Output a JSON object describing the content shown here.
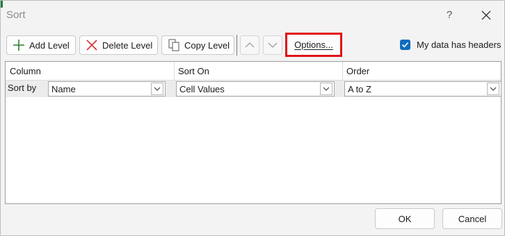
{
  "window": {
    "title": "Sort",
    "help_glyph": "?"
  },
  "toolbar": {
    "add_level": "Add Level",
    "delete_level": "Delete Level",
    "copy_level": "Copy Level",
    "options": "Options...",
    "headers_checkbox_label": "My data has headers",
    "headers_checked": true
  },
  "grid": {
    "columns": [
      "Column",
      "Sort On",
      "Order"
    ],
    "rows": [
      {
        "label": "Sort by",
        "column": "Name",
        "sort_on": "Cell Values",
        "order": "A to Z"
      }
    ]
  },
  "footer": {
    "ok": "OK",
    "cancel": "Cancel"
  },
  "colors": {
    "accent": "#0f6cbd",
    "highlight_box": "#e00f16",
    "add_icon": "#2e7d32",
    "delete_icon": "#d32f2f"
  }
}
